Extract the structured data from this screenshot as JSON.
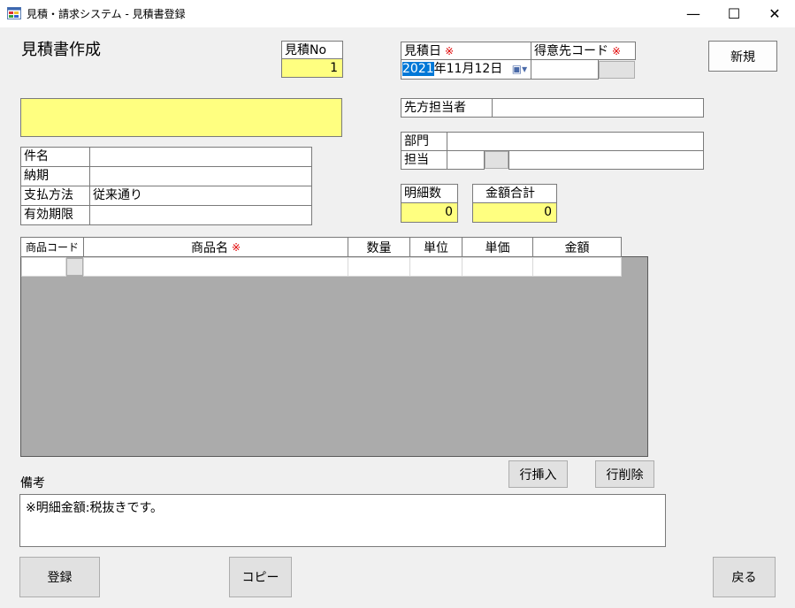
{
  "window": {
    "title": "見積・請求システム - 見積書登録",
    "minimize_glyph": "—",
    "maximize_glyph": "☐",
    "close_glyph": "✕"
  },
  "form": {
    "heading": "見積書作成",
    "estimate_no": {
      "label": "見積No",
      "value": "1"
    },
    "estimate_date": {
      "label": "見積日",
      "required_mark": "※",
      "year": "2021",
      "rest": "年11月12日",
      "dropdown_glyph": "▾"
    },
    "customer_code": {
      "label": "得意先コード",
      "required_mark": "※",
      "value": ""
    },
    "new_button": "新規",
    "customer_name": "",
    "contact_person": {
      "label": "先方担当者",
      "value": ""
    },
    "department": {
      "label": "部門",
      "value": ""
    },
    "staff": {
      "label": "担当",
      "code": "",
      "name": ""
    },
    "details": [
      {
        "label": "件名",
        "value": ""
      },
      {
        "label": "納期",
        "value": ""
      },
      {
        "label": "支払方法",
        "value": "従来通り"
      },
      {
        "label": "有効期限",
        "value": ""
      }
    ],
    "line_count": {
      "label": "明細数",
      "value": "0"
    },
    "total_amount": {
      "label": "金額合計",
      "value": "0"
    }
  },
  "grid": {
    "columns": [
      "商品コード",
      "商品名",
      "数量",
      "単位",
      "単価",
      "金額"
    ],
    "required_mark": "※"
  },
  "buttons": {
    "insert_row": "行挿入",
    "delete_row": "行削除",
    "register": "登録",
    "copy": "コピー",
    "back": "戻る"
  },
  "remarks": {
    "label": "備考",
    "value": "※明細金額:税抜きです。"
  }
}
